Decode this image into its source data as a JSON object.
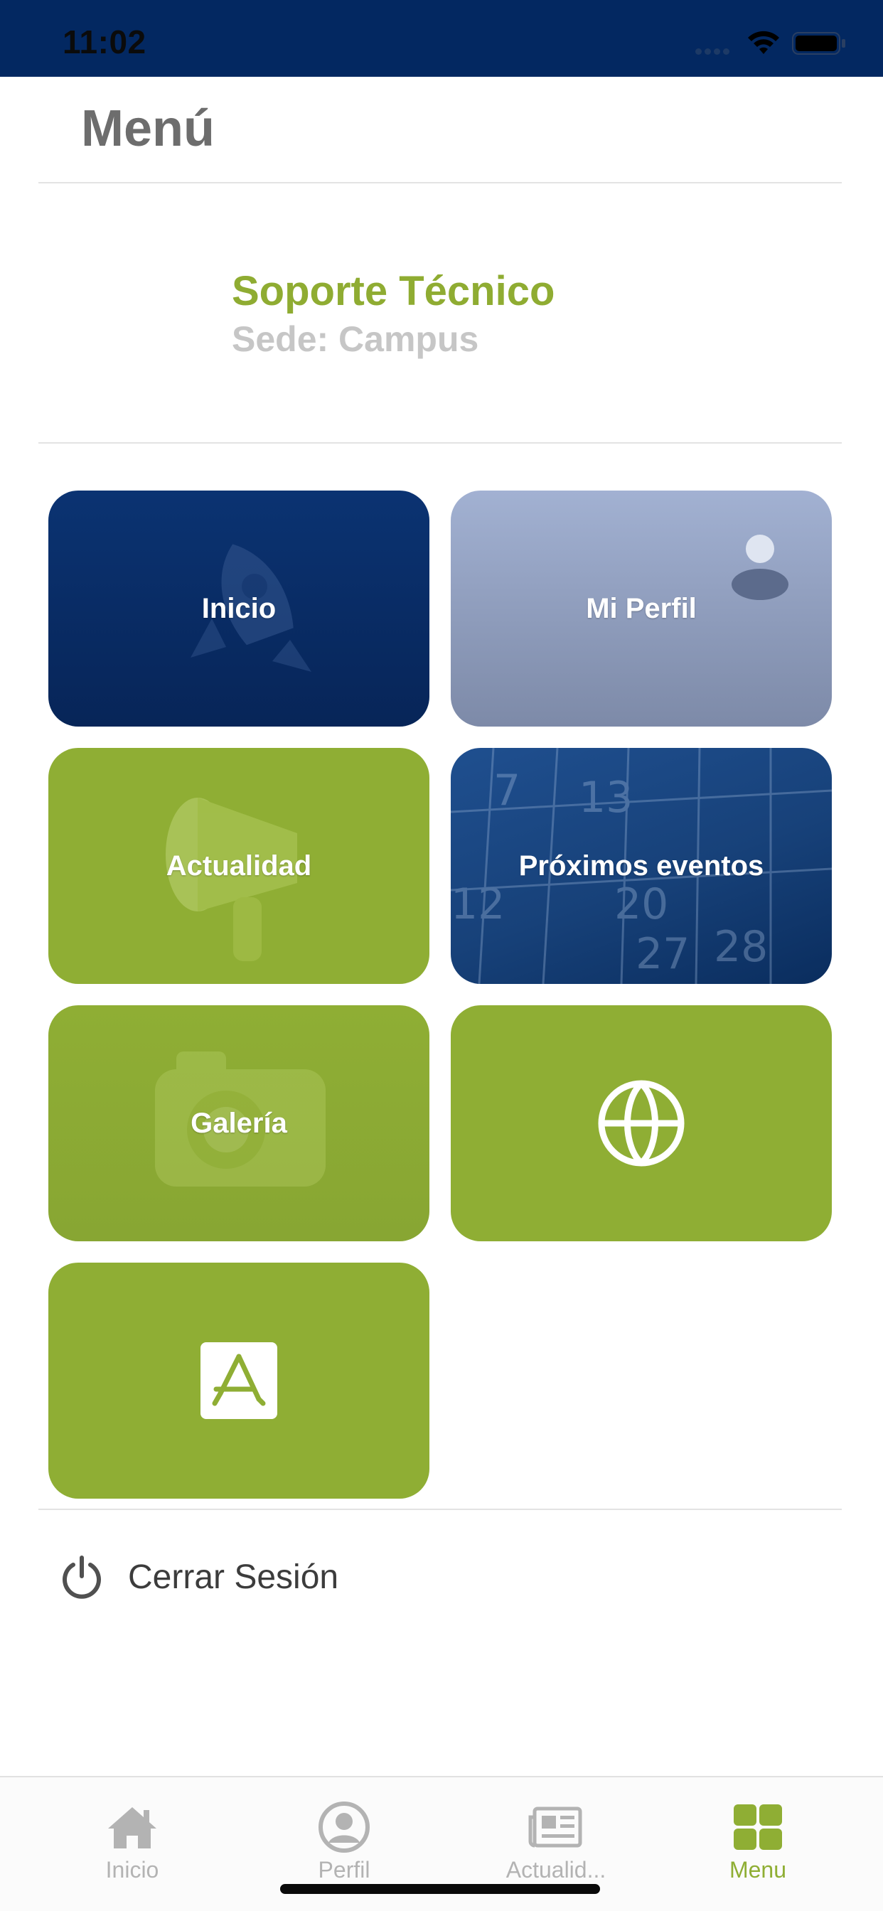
{
  "status_bar": {
    "time": "11:02"
  },
  "header": {
    "title": "Menú"
  },
  "profile": {
    "name": "Soporte Técnico",
    "site": "Sede: Campus"
  },
  "tiles": [
    {
      "label": "Inicio",
      "icon": "rocket-icon"
    },
    {
      "label": "Mi Perfil",
      "icon": "user-icon"
    },
    {
      "label": "Actualidad",
      "icon": "megaphone-icon"
    },
    {
      "label": "Próximos eventos",
      "icon": "calendar-icon"
    },
    {
      "label": "Galería",
      "icon": "camera-icon"
    },
    {
      "label": "",
      "icon": "globe-icon"
    },
    {
      "label": "",
      "icon": "app-store-icon"
    }
  ],
  "logout": {
    "label": "Cerrar Sesión",
    "icon": "power-icon"
  },
  "tab_bar": {
    "items": [
      {
        "label": "Inicio",
        "icon": "home-icon",
        "active": false
      },
      {
        "label": "Perfil",
        "icon": "person-icon",
        "active": false
      },
      {
        "label": "Actualid...",
        "icon": "newspaper-icon",
        "active": false
      },
      {
        "label": "Menu",
        "icon": "grid-icon",
        "active": true
      }
    ]
  },
  "colors": {
    "status_bar": "#032861",
    "accent_green": "#8fae34",
    "navy": "#072558",
    "title_gray": "#6d6d6d",
    "subtitle_gray": "#c6c6c6"
  }
}
